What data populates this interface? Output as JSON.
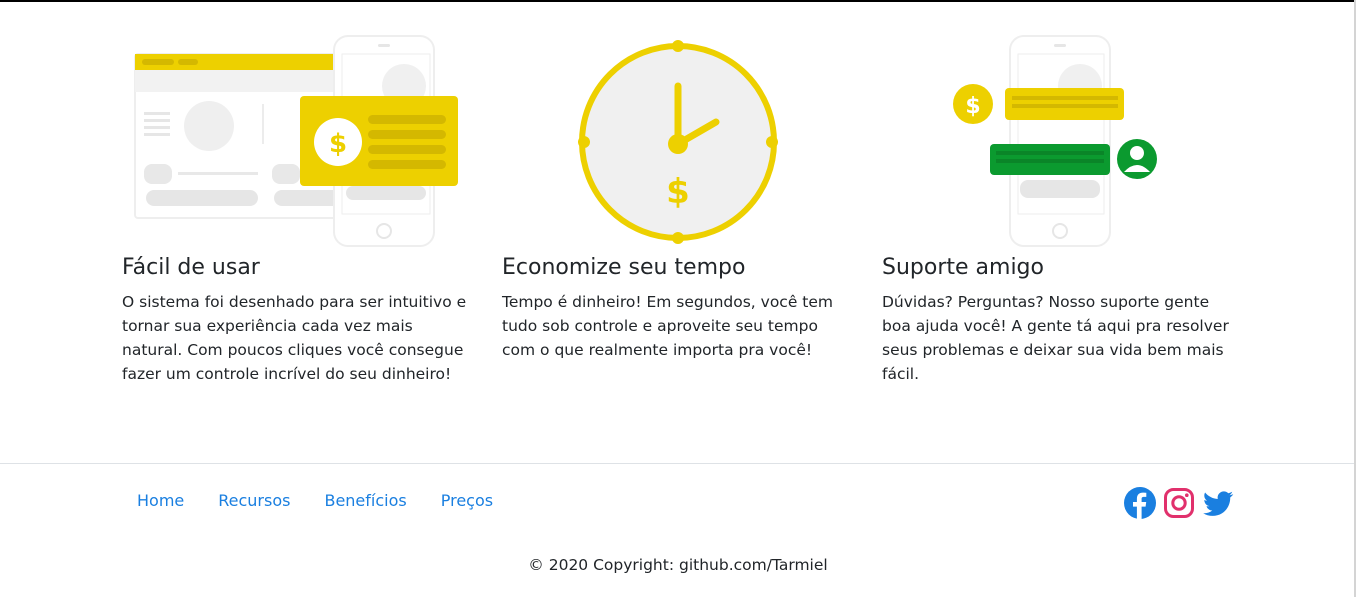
{
  "features": [
    {
      "title": "Fácil de usar",
      "text": "O sistema foi desenhado para ser intuitivo e tornar sua experiência cada vez mais natural. Com poucos cliques você consegue fazer um controle incrível do seu dinheiro!",
      "illustration": "desktop-mobile-payment-icon"
    },
    {
      "title": "Economize seu tempo",
      "text": "Tempo é dinheiro! Em segundos, você tem tudo sob controle e aproveite seu tempo com o que realmente importa pra você!",
      "illustration": "clock-money-icon"
    },
    {
      "title": "Suporte amigo",
      "text": "Dúvidas? Perguntas? Nosso suporte gente boa ajuda você! A gente tá aqui pra resolver seus problemas e deixar sua vida bem mais fácil.",
      "illustration": "chat-support-icon"
    }
  ],
  "footer": {
    "nav": [
      "Home",
      "Recursos",
      "Benefícios",
      "Preços"
    ],
    "social": [
      "facebook-icon",
      "instagram-icon",
      "twitter-icon"
    ],
    "copyright": "© 2020 Copyright: github.com/Tarmiel"
  },
  "colors": {
    "accent_yellow": "#edd000",
    "accent_green": "#0b9a2f",
    "link_blue": "#1a7fe0",
    "instagram": "#e1306c"
  }
}
